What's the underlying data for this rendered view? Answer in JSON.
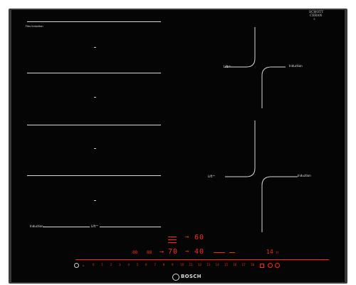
{
  "cooktop": {
    "model_label": "Flex Induction",
    "schott_logo_line1": "SCHOTT",
    "schott_logo_line2": "CERAN",
    "schott_logo_small": "®",
    "brand": "BOSCH",
    "zones_left_bottom": {
      "left_label": "Induction",
      "right_label": "Lift™"
    },
    "zones_right_top": {
      "left_label": "Lift™",
      "right_label": "Induction"
    },
    "zones_right_bottom": {
      "left_label": "Lift™",
      "right_label": "Induction"
    },
    "displays": {
      "top_digit": "6",
      "top_digit2": "0",
      "mid_left_digits": "7",
      "mid_left_digits2": "0",
      "mid_right_digits": "4",
      "mid_right_digits2": "0",
      "timer_digits": "14",
      "small_left": "88",
      "small_right": "88"
    },
    "slider_numbers": [
      "0",
      "1",
      "2",
      "3",
      "4",
      "5",
      "6",
      "7",
      "8",
      "9",
      "10",
      "11",
      "12",
      "13",
      "14",
      "15",
      "16",
      "17",
      "18"
    ],
    "accent_color": "#ff2b1a"
  }
}
